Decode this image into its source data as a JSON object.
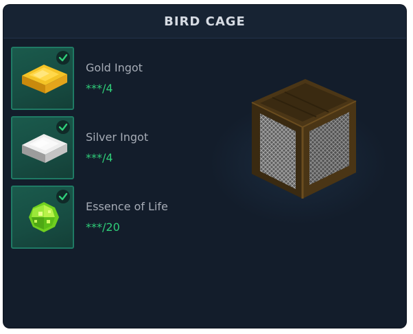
{
  "window": {
    "title": "BIRD CAGE"
  },
  "ingredients": [
    {
      "name": "Gold Ingot",
      "count": "***/4",
      "icon": "gold-ingot-icon"
    },
    {
      "name": "Silver Ingot",
      "count": "***/4",
      "icon": "silver-ingot-icon"
    },
    {
      "name": "Essence of Life",
      "count": "***/20",
      "icon": "essence-of-life-icon"
    }
  ],
  "preview": {
    "icon": "bird-cage-block-icon"
  },
  "colors": {
    "panel_bg": "#131d2b",
    "slot_bg": "#174c42",
    "slot_border": "#1f7a64",
    "check": "#2fce79",
    "count_text": "#2fce79",
    "name_text": "#a6acb6",
    "title_text": "#d6dbe3"
  }
}
